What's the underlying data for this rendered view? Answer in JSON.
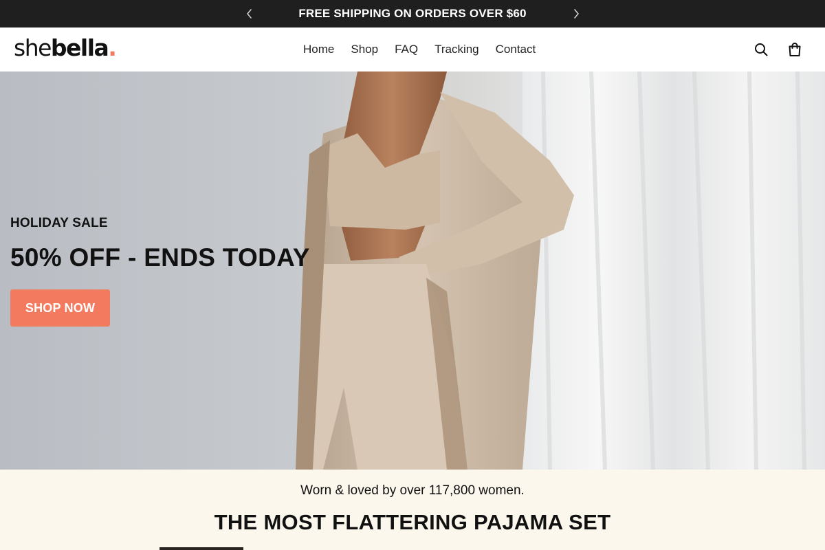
{
  "announcement": {
    "text": "FREE SHIPPING ON ORDERS OVER $60",
    "prev_icon": "chevron-left-icon",
    "next_icon": "chevron-right-icon"
  },
  "header": {
    "logo": {
      "part1": "she",
      "part2": "bella",
      "dot": "."
    },
    "nav": [
      {
        "label": "Home"
      },
      {
        "label": "Shop"
      },
      {
        "label": "FAQ"
      },
      {
        "label": "Tracking"
      },
      {
        "label": "Contact"
      }
    ],
    "icons": {
      "search": "search-icon",
      "cart": "shopping-bag-icon"
    }
  },
  "hero": {
    "kicker": "HOLIDAY SALE",
    "title": "50% OFF - ENDS TODAY",
    "cta_label": "SHOP NOW"
  },
  "proof": {
    "subtitle": "Worn & loved by over 117,800 women.",
    "title": "THE MOST FLATTERING PAJAMA SET"
  },
  "colors": {
    "announcement_bg": "#1f1f1f",
    "accent": "#f37a5e",
    "proof_bg": "#fbf7ec",
    "text": "#111111"
  }
}
